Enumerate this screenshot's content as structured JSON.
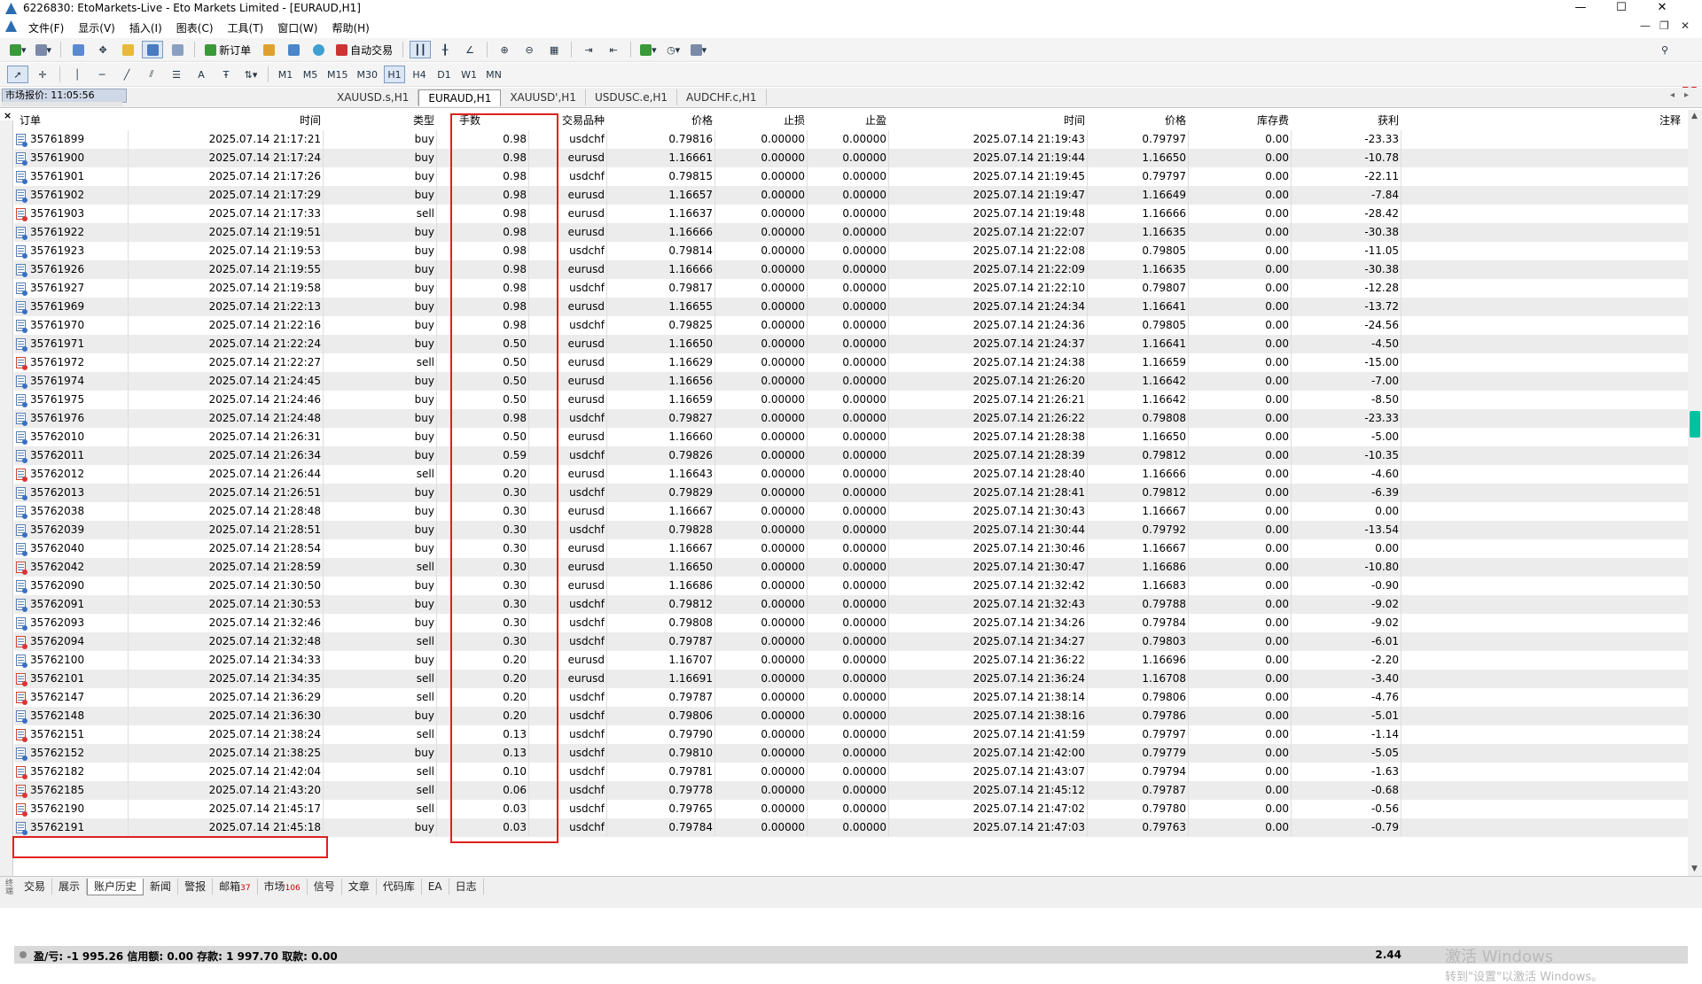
{
  "window": {
    "title": "6226830: EtoMarkets-Live - Eto Markets Limited - [EURAUD,H1]",
    "controls": [
      "—",
      "☐",
      "✕"
    ]
  },
  "menu": {
    "items": [
      "文件(F)",
      "显示(V)",
      "插入(I)",
      "图表(C)",
      "工具(T)",
      "窗口(W)",
      "帮助(H)"
    ],
    "child_controls": [
      "—",
      "❐",
      "✕"
    ]
  },
  "toolbar": {
    "new_order_label": "新订单",
    "auto_trading_label": "自动交易",
    "timeframes": [
      "M1",
      "M5",
      "M15",
      "M30",
      "H1",
      "H4",
      "D1",
      "W1",
      "MN"
    ],
    "active_timeframe": "H1",
    "chat_badge": "1"
  },
  "market_watch": {
    "label": "市场报价: 11:05:56"
  },
  "chart_tabs": {
    "tabs": [
      "XAUUSD.s,H1",
      "EURAUD,H1",
      "XAUUSD',H1",
      "USDUSC.e,H1",
      "AUDCHF.c,H1"
    ],
    "active": "EURAUD,H1"
  },
  "terminal": {
    "close_label": "×",
    "headers": {
      "order": "订单",
      "open_time": "时间",
      "type": "类型",
      "lots": "手数",
      "symbol": "交易品种",
      "open_price": "价格",
      "sl": "止损",
      "tp": "止盈",
      "close_time": "时间",
      "close_price": "价格",
      "swap": "库存费",
      "profit": "获利",
      "comment": "注释"
    },
    "rows": [
      {
        "order": "35761899",
        "open_time": "2025.07.14 21:17:21",
        "type": "buy",
        "lots": "0.98",
        "symbol": "usdchf",
        "open_price": "0.79816",
        "sl": "0.00000",
        "tp": "0.00000",
        "close_time": "2025.07.14 21:19:43",
        "close_price": "0.79797",
        "swap": "0.00",
        "profit": "-23.33"
      },
      {
        "order": "35761900",
        "open_time": "2025.07.14 21:17:24",
        "type": "buy",
        "lots": "0.98",
        "symbol": "eurusd",
        "open_price": "1.16661",
        "sl": "0.00000",
        "tp": "0.00000",
        "close_time": "2025.07.14 21:19:44",
        "close_price": "1.16650",
        "swap": "0.00",
        "profit": "-10.78"
      },
      {
        "order": "35761901",
        "open_time": "2025.07.14 21:17:26",
        "type": "buy",
        "lots": "0.98",
        "symbol": "usdchf",
        "open_price": "0.79815",
        "sl": "0.00000",
        "tp": "0.00000",
        "close_time": "2025.07.14 21:19:45",
        "close_price": "0.79797",
        "swap": "0.00",
        "profit": "-22.11"
      },
      {
        "order": "35761902",
        "open_time": "2025.07.14 21:17:29",
        "type": "buy",
        "lots": "0.98",
        "symbol": "eurusd",
        "open_price": "1.16657",
        "sl": "0.00000",
        "tp": "0.00000",
        "close_time": "2025.07.14 21:19:47",
        "close_price": "1.16649",
        "swap": "0.00",
        "profit": "-7.84"
      },
      {
        "order": "35761903",
        "open_time": "2025.07.14 21:17:33",
        "type": "sell",
        "lots": "0.98",
        "symbol": "eurusd",
        "open_price": "1.16637",
        "sl": "0.00000",
        "tp": "0.00000",
        "close_time": "2025.07.14 21:19:48",
        "close_price": "1.16666",
        "swap": "0.00",
        "profit": "-28.42"
      },
      {
        "order": "35761922",
        "open_time": "2025.07.14 21:19:51",
        "type": "buy",
        "lots": "0.98",
        "symbol": "eurusd",
        "open_price": "1.16666",
        "sl": "0.00000",
        "tp": "0.00000",
        "close_time": "2025.07.14 21:22:07",
        "close_price": "1.16635",
        "swap": "0.00",
        "profit": "-30.38"
      },
      {
        "order": "35761923",
        "open_time": "2025.07.14 21:19:53",
        "type": "buy",
        "lots": "0.98",
        "symbol": "usdchf",
        "open_price": "0.79814",
        "sl": "0.00000",
        "tp": "0.00000",
        "close_time": "2025.07.14 21:22:08",
        "close_price": "0.79805",
        "swap": "0.00",
        "profit": "-11.05"
      },
      {
        "order": "35761926",
        "open_time": "2025.07.14 21:19:55",
        "type": "buy",
        "lots": "0.98",
        "symbol": "eurusd",
        "open_price": "1.16666",
        "sl": "0.00000",
        "tp": "0.00000",
        "close_time": "2025.07.14 21:22:09",
        "close_price": "1.16635",
        "swap": "0.00",
        "profit": "-30.38"
      },
      {
        "order": "35761927",
        "open_time": "2025.07.14 21:19:58",
        "type": "buy",
        "lots": "0.98",
        "symbol": "usdchf",
        "open_price": "0.79817",
        "sl": "0.00000",
        "tp": "0.00000",
        "close_time": "2025.07.14 21:22:10",
        "close_price": "0.79807",
        "swap": "0.00",
        "profit": "-12.28"
      },
      {
        "order": "35761969",
        "open_time": "2025.07.14 21:22:13",
        "type": "buy",
        "lots": "0.98",
        "symbol": "eurusd",
        "open_price": "1.16655",
        "sl": "0.00000",
        "tp": "0.00000",
        "close_time": "2025.07.14 21:24:34",
        "close_price": "1.16641",
        "swap": "0.00",
        "profit": "-13.72"
      },
      {
        "order": "35761970",
        "open_time": "2025.07.14 21:22:16",
        "type": "buy",
        "lots": "0.98",
        "symbol": "usdchf",
        "open_price": "0.79825",
        "sl": "0.00000",
        "tp": "0.00000",
        "close_time": "2025.07.14 21:24:36",
        "close_price": "0.79805",
        "swap": "0.00",
        "profit": "-24.56"
      },
      {
        "order": "35761971",
        "open_time": "2025.07.14 21:22:24",
        "type": "buy",
        "lots": "0.50",
        "symbol": "eurusd",
        "open_price": "1.16650",
        "sl": "0.00000",
        "tp": "0.00000",
        "close_time": "2025.07.14 21:24:37",
        "close_price": "1.16641",
        "swap": "0.00",
        "profit": "-4.50"
      },
      {
        "order": "35761972",
        "open_time": "2025.07.14 21:22:27",
        "type": "sell",
        "lots": "0.50",
        "symbol": "eurusd",
        "open_price": "1.16629",
        "sl": "0.00000",
        "tp": "0.00000",
        "close_time": "2025.07.14 21:24:38",
        "close_price": "1.16659",
        "swap": "0.00",
        "profit": "-15.00"
      },
      {
        "order": "35761974",
        "open_time": "2025.07.14 21:24:45",
        "type": "buy",
        "lots": "0.50",
        "symbol": "eurusd",
        "open_price": "1.16656",
        "sl": "0.00000",
        "tp": "0.00000",
        "close_time": "2025.07.14 21:26:20",
        "close_price": "1.16642",
        "swap": "0.00",
        "profit": "-7.00"
      },
      {
        "order": "35761975",
        "open_time": "2025.07.14 21:24:46",
        "type": "buy",
        "lots": "0.50",
        "symbol": "eurusd",
        "open_price": "1.16659",
        "sl": "0.00000",
        "tp": "0.00000",
        "close_time": "2025.07.14 21:26:21",
        "close_price": "1.16642",
        "swap": "0.00",
        "profit": "-8.50"
      },
      {
        "order": "35761976",
        "open_time": "2025.07.14 21:24:48",
        "type": "buy",
        "lots": "0.98",
        "symbol": "usdchf",
        "open_price": "0.79827",
        "sl": "0.00000",
        "tp": "0.00000",
        "close_time": "2025.07.14 21:26:22",
        "close_price": "0.79808",
        "swap": "0.00",
        "profit": "-23.33"
      },
      {
        "order": "35762010",
        "open_time": "2025.07.14 21:26:31",
        "type": "buy",
        "lots": "0.50",
        "symbol": "eurusd",
        "open_price": "1.16660",
        "sl": "0.00000",
        "tp": "0.00000",
        "close_time": "2025.07.14 21:28:38",
        "close_price": "1.16650",
        "swap": "0.00",
        "profit": "-5.00"
      },
      {
        "order": "35762011",
        "open_time": "2025.07.14 21:26:34",
        "type": "buy",
        "lots": "0.59",
        "symbol": "usdchf",
        "open_price": "0.79826",
        "sl": "0.00000",
        "tp": "0.00000",
        "close_time": "2025.07.14 21:28:39",
        "close_price": "0.79812",
        "swap": "0.00",
        "profit": "-10.35"
      },
      {
        "order": "35762012",
        "open_time": "2025.07.14 21:26:44",
        "type": "sell",
        "lots": "0.20",
        "symbol": "eurusd",
        "open_price": "1.16643",
        "sl": "0.00000",
        "tp": "0.00000",
        "close_time": "2025.07.14 21:28:40",
        "close_price": "1.16666",
        "swap": "0.00",
        "profit": "-4.60"
      },
      {
        "order": "35762013",
        "open_time": "2025.07.14 21:26:51",
        "type": "buy",
        "lots": "0.30",
        "symbol": "usdchf",
        "open_price": "0.79829",
        "sl": "0.00000",
        "tp": "0.00000",
        "close_time": "2025.07.14 21:28:41",
        "close_price": "0.79812",
        "swap": "0.00",
        "profit": "-6.39"
      },
      {
        "order": "35762038",
        "open_time": "2025.07.14 21:28:48",
        "type": "buy",
        "lots": "0.30",
        "symbol": "eurusd",
        "open_price": "1.16667",
        "sl": "0.00000",
        "tp": "0.00000",
        "close_time": "2025.07.14 21:30:43",
        "close_price": "1.16667",
        "swap": "0.00",
        "profit": "0.00"
      },
      {
        "order": "35762039",
        "open_time": "2025.07.14 21:28:51",
        "type": "buy",
        "lots": "0.30",
        "symbol": "usdchf",
        "open_price": "0.79828",
        "sl": "0.00000",
        "tp": "0.00000",
        "close_time": "2025.07.14 21:30:44",
        "close_price": "0.79792",
        "swap": "0.00",
        "profit": "-13.54"
      },
      {
        "order": "35762040",
        "open_time": "2025.07.14 21:28:54",
        "type": "buy",
        "lots": "0.30",
        "symbol": "eurusd",
        "open_price": "1.16667",
        "sl": "0.00000",
        "tp": "0.00000",
        "close_time": "2025.07.14 21:30:46",
        "close_price": "1.16667",
        "swap": "0.00",
        "profit": "0.00"
      },
      {
        "order": "35762042",
        "open_time": "2025.07.14 21:28:59",
        "type": "sell",
        "lots": "0.30",
        "symbol": "eurusd",
        "open_price": "1.16650",
        "sl": "0.00000",
        "tp": "0.00000",
        "close_time": "2025.07.14 21:30:47",
        "close_price": "1.16686",
        "swap": "0.00",
        "profit": "-10.80"
      },
      {
        "order": "35762090",
        "open_time": "2025.07.14 21:30:50",
        "type": "buy",
        "lots": "0.30",
        "symbol": "eurusd",
        "open_price": "1.16686",
        "sl": "0.00000",
        "tp": "0.00000",
        "close_time": "2025.07.14 21:32:42",
        "close_price": "1.16683",
        "swap": "0.00",
        "profit": "-0.90"
      },
      {
        "order": "35762091",
        "open_time": "2025.07.14 21:30:53",
        "type": "buy",
        "lots": "0.30",
        "symbol": "usdchf",
        "open_price": "0.79812",
        "sl": "0.00000",
        "tp": "0.00000",
        "close_time": "2025.07.14 21:32:43",
        "close_price": "0.79788",
        "swap": "0.00",
        "profit": "-9.02"
      },
      {
        "order": "35762093",
        "open_time": "2025.07.14 21:32:46",
        "type": "buy",
        "lots": "0.30",
        "symbol": "usdchf",
        "open_price": "0.79808",
        "sl": "0.00000",
        "tp": "0.00000",
        "close_time": "2025.07.14 21:34:26",
        "close_price": "0.79784",
        "swap": "0.00",
        "profit": "-9.02"
      },
      {
        "order": "35762094",
        "open_time": "2025.07.14 21:32:48",
        "type": "sell",
        "lots": "0.30",
        "symbol": "usdchf",
        "open_price": "0.79787",
        "sl": "0.00000",
        "tp": "0.00000",
        "close_time": "2025.07.14 21:34:27",
        "close_price": "0.79803",
        "swap": "0.00",
        "profit": "-6.01"
      },
      {
        "order": "35762100",
        "open_time": "2025.07.14 21:34:33",
        "type": "buy",
        "lots": "0.20",
        "symbol": "eurusd",
        "open_price": "1.16707",
        "sl": "0.00000",
        "tp": "0.00000",
        "close_time": "2025.07.14 21:36:22",
        "close_price": "1.16696",
        "swap": "0.00",
        "profit": "-2.20"
      },
      {
        "order": "35762101",
        "open_time": "2025.07.14 21:34:35",
        "type": "sell",
        "lots": "0.20",
        "symbol": "eurusd",
        "open_price": "1.16691",
        "sl": "0.00000",
        "tp": "0.00000",
        "close_time": "2025.07.14 21:36:24",
        "close_price": "1.16708",
        "swap": "0.00",
        "profit": "-3.40"
      },
      {
        "order": "35762147",
        "open_time": "2025.07.14 21:36:29",
        "type": "sell",
        "lots": "0.20",
        "symbol": "usdchf",
        "open_price": "0.79787",
        "sl": "0.00000",
        "tp": "0.00000",
        "close_time": "2025.07.14 21:38:14",
        "close_price": "0.79806",
        "swap": "0.00",
        "profit": "-4.76"
      },
      {
        "order": "35762148",
        "open_time": "2025.07.14 21:36:30",
        "type": "buy",
        "lots": "0.20",
        "symbol": "usdchf",
        "open_price": "0.79806",
        "sl": "0.00000",
        "tp": "0.00000",
        "close_time": "2025.07.14 21:38:16",
        "close_price": "0.79786",
        "swap": "0.00",
        "profit": "-5.01"
      },
      {
        "order": "35762151",
        "open_time": "2025.07.14 21:38:24",
        "type": "sell",
        "lots": "0.13",
        "symbol": "usdchf",
        "open_price": "0.79790",
        "sl": "0.00000",
        "tp": "0.00000",
        "close_time": "2025.07.14 21:41:59",
        "close_price": "0.79797",
        "swap": "0.00",
        "profit": "-1.14"
      },
      {
        "order": "35762152",
        "open_time": "2025.07.14 21:38:25",
        "type": "buy",
        "lots": "0.13",
        "symbol": "usdchf",
        "open_price": "0.79810",
        "sl": "0.00000",
        "tp": "0.00000",
        "close_time": "2025.07.14 21:42:00",
        "close_price": "0.79779",
        "swap": "0.00",
        "profit": "-5.05"
      },
      {
        "order": "35762182",
        "open_time": "2025.07.14 21:42:04",
        "type": "sell",
        "lots": "0.10",
        "symbol": "usdchf",
        "open_price": "0.79781",
        "sl": "0.00000",
        "tp": "0.00000",
        "close_time": "2025.07.14 21:43:07",
        "close_price": "0.79794",
        "swap": "0.00",
        "profit": "-1.63"
      },
      {
        "order": "35762185",
        "open_time": "2025.07.14 21:43:20",
        "type": "sell",
        "lots": "0.06",
        "symbol": "usdchf",
        "open_price": "0.79778",
        "sl": "0.00000",
        "tp": "0.00000",
        "close_time": "2025.07.14 21:45:12",
        "close_price": "0.79787",
        "swap": "0.00",
        "profit": "-0.68"
      },
      {
        "order": "35762190",
        "open_time": "2025.07.14 21:45:17",
        "type": "sell",
        "lots": "0.03",
        "symbol": "usdchf",
        "open_price": "0.79765",
        "sl": "0.00000",
        "tp": "0.00000",
        "close_time": "2025.07.14 21:47:02",
        "close_price": "0.79780",
        "swap": "0.00",
        "profit": "-0.56"
      },
      {
        "order": "35762191",
        "open_time": "2025.07.14 21:45:18",
        "type": "buy",
        "lots": "0.03",
        "symbol": "usdchf",
        "open_price": "0.79784",
        "sl": "0.00000",
        "tp": "0.00000",
        "close_time": "2025.07.14 21:47:03",
        "close_price": "0.79763",
        "swap": "0.00",
        "profit": "-0.79"
      }
    ],
    "summary": {
      "text": "盈/亏: -1 995.26  信用额: 0.00  存款: 1 997.70  取款: 0.00",
      "total_profit": "2.44"
    }
  },
  "bottom_tabs": {
    "tabs": [
      {
        "label": "交易",
        "count": ""
      },
      {
        "label": "展示",
        "count": ""
      },
      {
        "label": "账户历史",
        "count": ""
      },
      {
        "label": "新闻",
        "count": ""
      },
      {
        "label": "警报",
        "count": ""
      },
      {
        "label": "邮箱",
        "count": "37"
      },
      {
        "label": "市场",
        "count": "106"
      },
      {
        "label": "信号",
        "count": ""
      },
      {
        "label": "文章",
        "count": ""
      },
      {
        "label": "代码库",
        "count": ""
      },
      {
        "label": "EA",
        "count": ""
      },
      {
        "label": "日志",
        "count": ""
      }
    ],
    "active": "账户历史",
    "vertical_title": "终端"
  },
  "activation_watermark": {
    "line1": "激活 Windows",
    "line2": "转到\"设置\"以激活 Windows。"
  },
  "colors": {
    "highlight_box": "#e02020",
    "alt_row": "#ececec",
    "summary_bg": "#d9d9d9"
  }
}
